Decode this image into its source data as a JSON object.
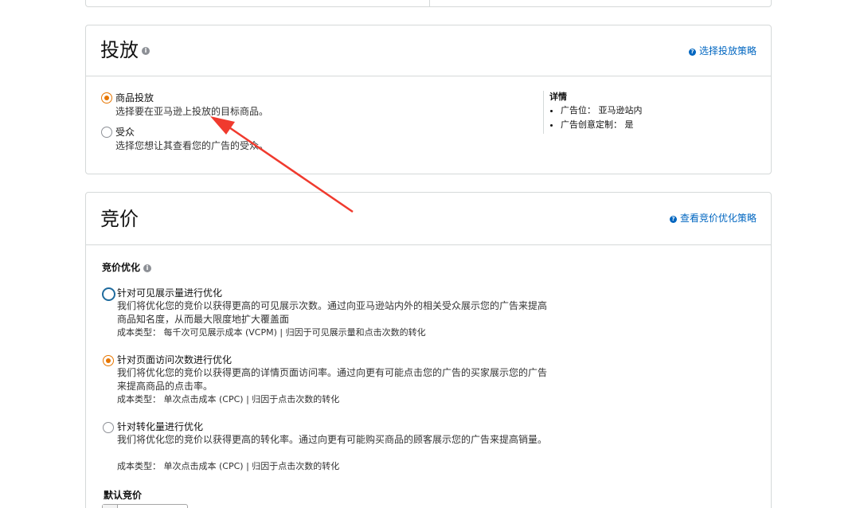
{
  "targeting": {
    "title": "投放",
    "help_link": "选择投放策略",
    "options": [
      {
        "title": "商品投放",
        "desc": "选择要在亚马逊上投放的目标商品。",
        "selected": true
      },
      {
        "title": "受众",
        "desc": "选择您想让其查看您的广告的受众。",
        "selected": false
      }
    ],
    "details": {
      "title": "详情",
      "items": [
        "广告位： 亚马逊站内",
        "广告创意定制： 是"
      ]
    }
  },
  "bidding": {
    "title": "竞价",
    "help_link": "查看竞价优化策略",
    "optimization_label": "竞价优化",
    "options": [
      {
        "title": "针对可见展示量进行优化",
        "desc_line1": "我们将优化您的竞价以获得更高的可见展示次数。通过向亚马逊站内外的相关受众展示您的广告来提高",
        "desc_line2": "商品知名度，从而最大限度地扩大覆盖面",
        "meta": "成本类型： 每千次可见展示成本 (VCPM) | 归因于可见展示量和点击次数的转化",
        "selected": false
      },
      {
        "title": "针对页面访问次数进行优化",
        "desc_line1": "我们将优化您的竞价以获得更高的详情页面访问率。通过向更有可能点击您的广告的买家展示您的广告",
        "desc_line2": "来提高商品的点击率。",
        "meta": "成本类型： 单次点击成本 (CPC) | 归因于点击次数的转化",
        "selected": true
      },
      {
        "title": "针对转化量进行优化",
        "desc_line1": "我们将优化您的竞价以获得更高的转化率。通过向更有可能购买商品的顾客展示您的广告来提高销量。",
        "desc_line2": "",
        "meta": "成本类型： 单次点击成本 (CPC) | 归因于点击次数的转化",
        "selected": false
      }
    ],
    "default_bid_label": "默认竞价"
  },
  "colors": {
    "accent": "#e77600",
    "link": "#0066c0",
    "annotation_arrow": "#f03a2e"
  }
}
